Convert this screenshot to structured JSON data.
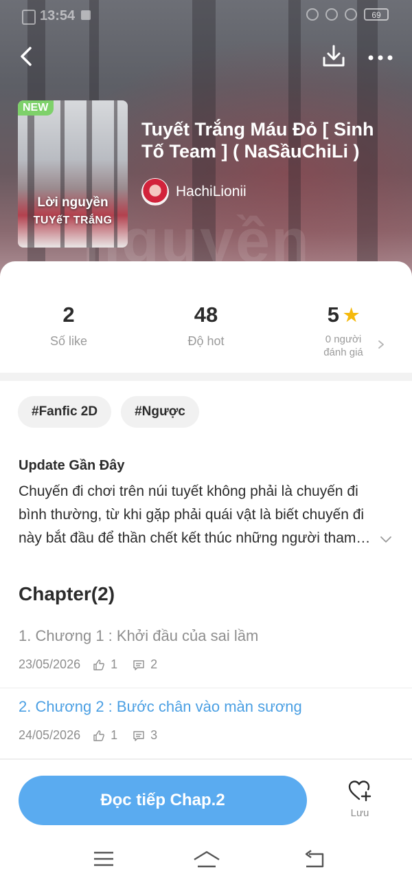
{
  "status_bar": {
    "time": "13:54",
    "battery": "69"
  },
  "story": {
    "badge": "NEW",
    "cover_line1": "Lời nguyền",
    "cover_line2": "TUYếT TRắNG",
    "title": "Tuyết Trắng Máu Đỏ [ Sinh Tố Team ] ( NaSầuChiLi )",
    "author": "HachiLionii"
  },
  "stats": {
    "likes": {
      "value": "2",
      "label": "Số like"
    },
    "hot": {
      "value": "48",
      "label": "Độ hot"
    },
    "rating": {
      "value": "5",
      "label_line1": "0 người",
      "label_line2": "đánh giá"
    }
  },
  "tags": [
    "#Fanfic 2D",
    "#Ngược"
  ],
  "update": {
    "title": "Update Gần Đây",
    "body": "Chuyến đi chơi trên núi tuyết không phải là chuyến đi bình thường, từ khi gặp phải quái vật là biết chuyến đi này bắt đầu để thần chết kết thúc những người tham gia chuyến đi này."
  },
  "chapters_header": "Chapter(2)",
  "chapters": [
    {
      "title": "1. Chương 1 : Khởi đầu của sai lầm",
      "date": "23/05/2026",
      "likes": "1",
      "comments": "2",
      "current": false
    },
    {
      "title": "2. Chương 2 : Bước chân vào màn sương",
      "date": "24/05/2026",
      "likes": "1",
      "comments": "3",
      "current": true
    }
  ],
  "actions": {
    "continue_label": "Đọc tiếp Chap.2",
    "save_label": "Lưu"
  },
  "colors": {
    "accent": "#5aabf0",
    "current_chapter": "#4a9fe3",
    "star": "#f5b90c",
    "new_badge": "#7ed16a"
  },
  "icons": [
    "back-icon",
    "download-icon",
    "more-icon",
    "star-icon",
    "chevron-right-icon",
    "chevron-down-icon",
    "thumb-up-icon",
    "comment-icon",
    "heart-plus-icon",
    "menu-icon",
    "home-icon",
    "back-nav-icon"
  ]
}
